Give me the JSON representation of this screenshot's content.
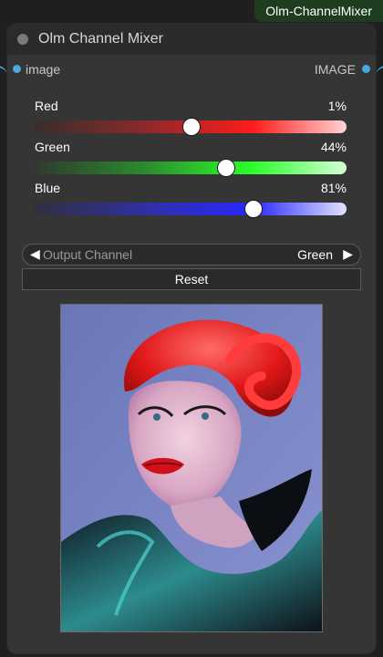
{
  "tag": {
    "text": "Olm-ChannelMixer"
  },
  "node": {
    "title": "Olm Channel Mixer",
    "input_slot": "image",
    "output_slot": "IMAGE"
  },
  "sliders": [
    {
      "label": "Red",
      "value_text": "1%",
      "level": 0.5
    },
    {
      "label": "Green",
      "value_text": "44%",
      "level": 0.61
    },
    {
      "label": "Blue",
      "value_text": "81%",
      "level": 0.7
    }
  ],
  "output_channel": {
    "label": "Output Channel",
    "value": "Green"
  },
  "reset_label": "Reset",
  "colors": {
    "accent_slot": "#4aa8e0",
    "tag_bg": "#1e3d1e",
    "node_bg": "#353535",
    "header_bg": "#2b2b2b"
  },
  "icons": [
    "title-dot-icon",
    "chevron-left-icon",
    "chevron-right-icon",
    "input-slot-icon",
    "output-slot-icon"
  ]
}
